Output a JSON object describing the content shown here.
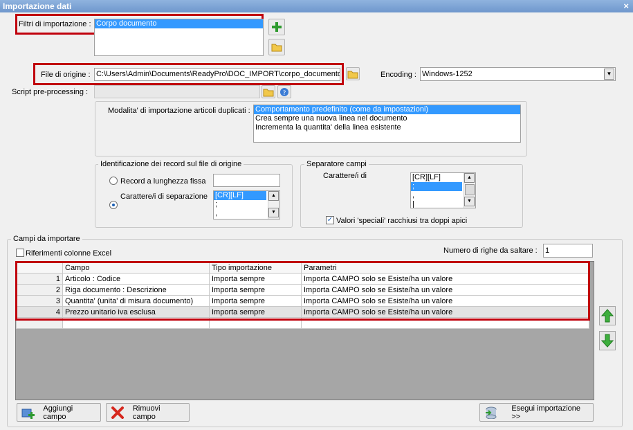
{
  "window": {
    "title": "Importazione dati",
    "close_glyph": "×"
  },
  "filters": {
    "label": "Filtri di importazione :",
    "items": [
      "Corpo documento"
    ]
  },
  "source_file": {
    "label": "File di origine :",
    "value": "C:\\Users\\Admin\\Documents\\ReadyPro\\DOC_IMPORT\\corpo_documento.c"
  },
  "encoding": {
    "label": "Encoding :",
    "value": "Windows-1252"
  },
  "script": {
    "label": "Script pre-processing :",
    "value": ""
  },
  "duplicates": {
    "label": "Modalita' di importazione articoli duplicati :",
    "options": [
      "Comportamento predefinito (come da impostazioni)",
      "Crea sempre una nuova linea nel documento",
      "Incrementa la quantita' della linea esistente"
    ],
    "selected_index": 0
  },
  "record_id": {
    "title": "Identificazione dei record sul file di origine",
    "fixed_length_label": "Record a lunghezza fissa",
    "separator_label": "Carattere/i di separazione",
    "selected": "separator",
    "separator_items": [
      "[CR][LF]",
      ";",
      ","
    ]
  },
  "field_separator": {
    "title": "Separatore campi",
    "chars_label": "Carattere/i di",
    "items": [
      "[CR][LF]",
      ";",
      ",",
      "|"
    ],
    "selected_index": 1,
    "quoted_label": "Valori 'speciali' racchiusi tra doppi apici",
    "quoted_checked": true
  },
  "fields_section": {
    "title": "Campi da importare",
    "excel_refs_label": "Riferimenti colonne Excel",
    "excel_refs_checked": false,
    "skip_rows_label": "Numero di righe da saltare :",
    "skip_rows_value": "1"
  },
  "grid": {
    "headers": [
      "",
      "Campo",
      "Tipo importazione",
      "Parametri"
    ],
    "rows": [
      {
        "n": "1",
        "campo": "Articolo : Codice",
        "tipo": "Importa sempre",
        "param": "Importa CAMPO solo se Esiste/ha un valore"
      },
      {
        "n": "2",
        "campo": "Riga documento : Descrizione",
        "tipo": "Importa sempre",
        "param": "Importa CAMPO solo se Esiste/ha un valore"
      },
      {
        "n": "3",
        "campo": "Quantita' (unita' di misura documento)",
        "tipo": "Importa sempre",
        "param": "Importa CAMPO solo se Esiste/ha un valore"
      },
      {
        "n": "4",
        "campo": "Prezzo unitario iva esclusa",
        "tipo": "Importa sempre",
        "param": "Importa CAMPO solo se Esiste/ha un valore"
      }
    ]
  },
  "buttons": {
    "add_field": "Aggiungi campo",
    "remove_field": "Rimuovi campo",
    "run_import": "Esegui importazione >>"
  },
  "colors": {
    "highlight": "#c0000c",
    "selection": "#3399ff",
    "title_bar": "#7aa0d2"
  }
}
